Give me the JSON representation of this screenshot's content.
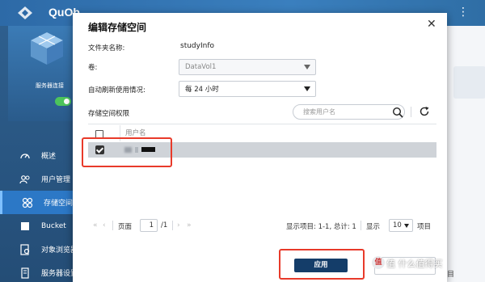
{
  "app": {
    "title": "QuOb"
  },
  "sidebar": {
    "status_label": "服务器连接",
    "toggle_text": "开",
    "items": [
      {
        "label": "概述",
        "icon": "gauge-icon"
      },
      {
        "label": "用户管理",
        "icon": "users-icon"
      },
      {
        "label": "存储空间",
        "icon": "storage-icon",
        "active": true
      },
      {
        "label": "Bucket",
        "icon": "bucket-icon"
      },
      {
        "label": "对象浏览器",
        "icon": "browser-icon"
      },
      {
        "label": "服务器设置",
        "icon": "server-icon"
      }
    ]
  },
  "background": {
    "right_tail": "目"
  },
  "dialog": {
    "title": "编辑存储空间",
    "folder_label": "文件夹名称:",
    "folder_value": "studyInfo",
    "volume_label": "卷:",
    "volume_value": "DataVol1",
    "refresh_label": "自动刷新使用情况:",
    "refresh_value": "每 24 小时",
    "permission_label": "存储空间权限",
    "search_placeholder": "搜索用户名",
    "column_username": "用户名",
    "pager": {
      "page_label": "页面",
      "page_value": "1",
      "page_total": "/1",
      "display_items": "显示项目: 1-1, 总计: 1",
      "display_label": "显示",
      "per_page": "10",
      "items_label": "项目"
    },
    "apply_label": "应用"
  },
  "watermark": "值 什么值得买",
  "colors": {
    "accent": "#143d69",
    "highlight": "#e83a2a",
    "selected_row": "#cfd3d8"
  }
}
